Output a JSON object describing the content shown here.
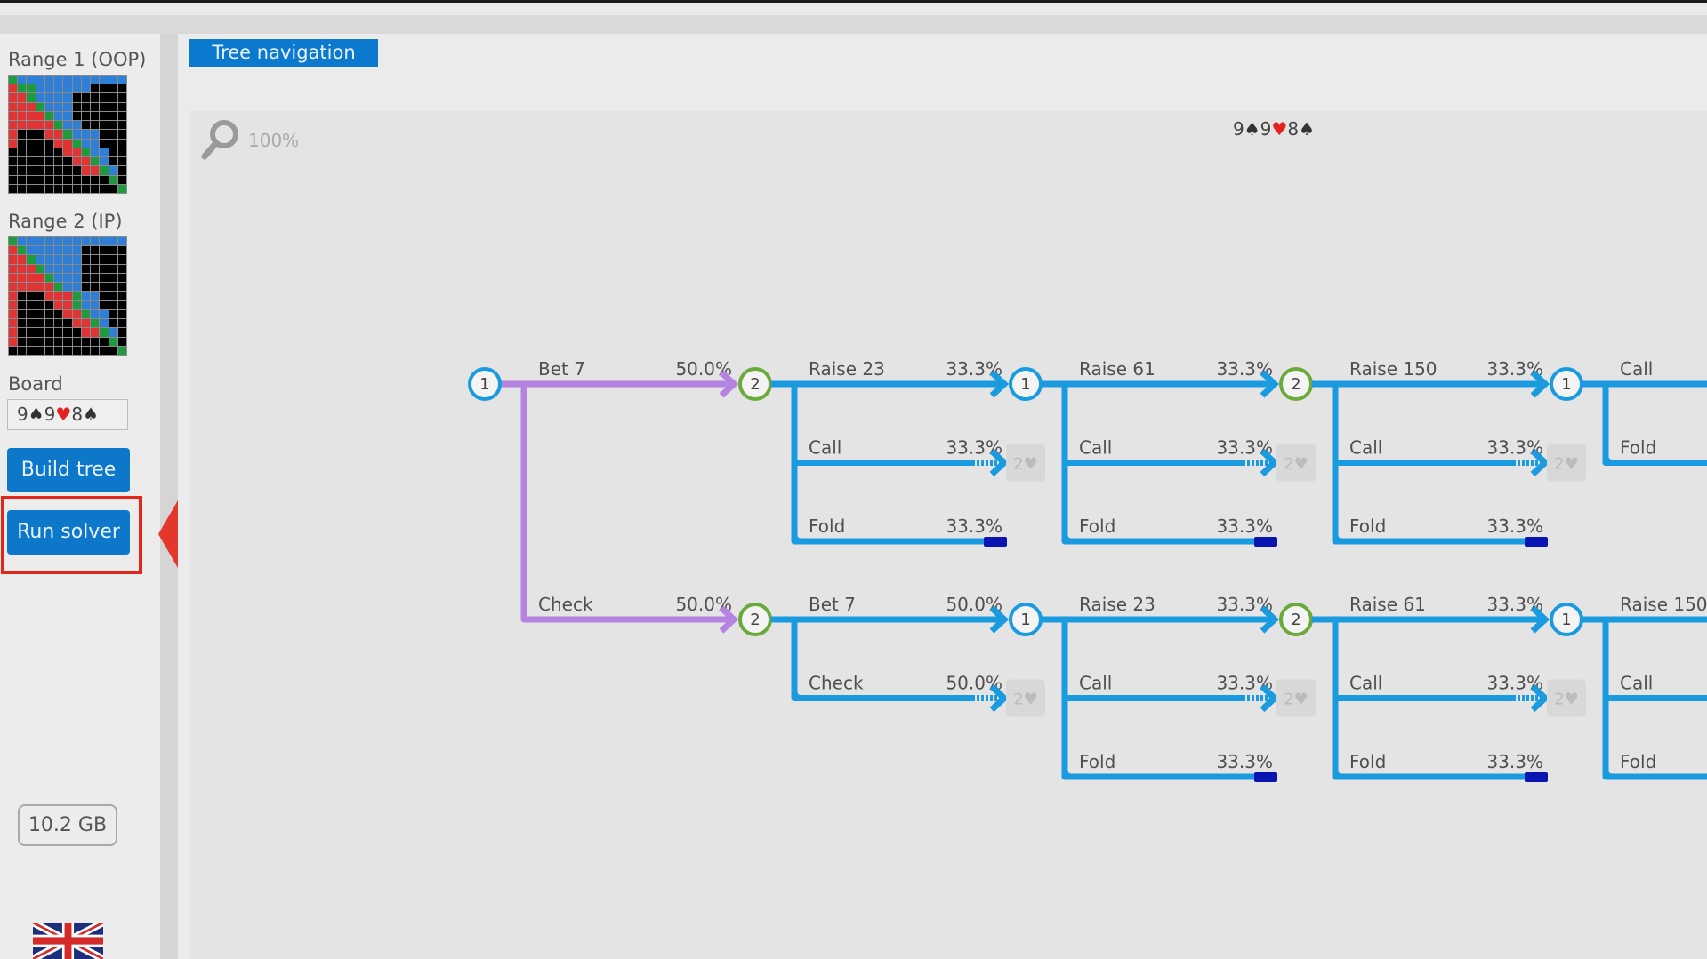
{
  "sidebar": {
    "range1_label": "Range 1 (OOP)",
    "range2_label": "Range 2 (IP)",
    "board_label": "Board",
    "board_cards": [
      {
        "rank": "9",
        "suit": "♠",
        "suit_color": "#333333"
      },
      {
        "rank": "9",
        "suit": "♥",
        "suit_color": "#e32222"
      },
      {
        "rank": "8",
        "suit": "♠",
        "suit_color": "#333333"
      }
    ],
    "build_tree_label": "Build tree",
    "run_solver_label": "Run solver",
    "memory_label": "10.2 GB",
    "language_flag": "uk-flag"
  },
  "range_colors": {
    "pair": "#1f9a3e",
    "suited": "#2f7fd6",
    "offsuit": "#e03434",
    "empty": "#000000"
  },
  "ranges": {
    "range1_rows": [
      "gsssssssssssss",
      "oggsssssseeee",
      "oogsssseeeee",
      "ooogssseeeee",
      "oooogsseeeee",
      "ooooogsseeee",
      "oeeeoogssseee",
      "oeeeeoogssee",
      "eeeeeeoogssee",
      "eeeeeeeoogse",
      "eeeeeeeeoogse",
      "eeeeeeeeeeege",
      "eeeeeeeeeeeeg"
    ],
    "range2_rows": [
      "gssssssssssss",
      "ogsssssseeee",
      "oogssssseeeee",
      "ooogsssseeee",
      "oooogssseeeee",
      "ooooogsseeeee",
      "oeeeooogsseee",
      "oeeeeoogsseee",
      "oeeeeeoogssee",
      "oeeeeeeoogsee",
      "oeeeeeeeoogse",
      "oeeeeeeeeeege",
      "eeeeeeeeeeeeg"
    ]
  },
  "main": {
    "tab_label": "Tree navigation",
    "zoom_label": "100%",
    "board_display": [
      {
        "rank": "9",
        "suit": "♠",
        "suit_color": "#333333"
      },
      {
        "rank": "9",
        "suit": "♥",
        "suit_color": "#e32222"
      },
      {
        "rank": "8",
        "suit": "♠",
        "suit_color": "#333333"
      }
    ]
  },
  "tree_colors": {
    "root_edge": "#b583e0",
    "edge": "#1a9be0",
    "p1_node": "#1a9be0",
    "p2_node": "#6aaa3c",
    "fold_terminal": "#0a14b0",
    "card_box": "#d8d8d8"
  },
  "tree": {
    "root": {
      "player": "1"
    },
    "root_actions": [
      {
        "label": "Bet 7",
        "pct": "50.0%",
        "next": "2"
      },
      {
        "label": "Check",
        "pct": "50.0%",
        "next": "2"
      }
    ],
    "next_card_label": "2♥",
    "groups": [
      {
        "columns": [
          {
            "actions": [
              {
                "label": "Raise 23",
                "pct": "33.3%",
                "type": "node",
                "next": "1"
              },
              {
                "label": "Call",
                "pct": "33.3%",
                "type": "card"
              },
              {
                "label": "Fold",
                "pct": "33.3%",
                "type": "fold"
              }
            ]
          },
          {
            "actions": [
              {
                "label": "Raise 61",
                "pct": "33.3%",
                "type": "node",
                "next": "2"
              },
              {
                "label": "Call",
                "pct": "33.3%",
                "type": "card"
              },
              {
                "label": "Fold",
                "pct": "33.3%",
                "type": "fold"
              }
            ]
          },
          {
            "actions": [
              {
                "label": "Raise 150",
                "pct": "33.3%",
                "type": "node",
                "next": "1"
              },
              {
                "label": "Call",
                "pct": "33.3%",
                "type": "card"
              },
              {
                "label": "Fold",
                "pct": "33.3%",
                "type": "fold"
              }
            ]
          },
          {
            "actions": [
              {
                "label": "Call",
                "pct": "",
                "type": "cut"
              },
              {
                "label": "Fold",
                "pct": "",
                "type": "cut"
              }
            ]
          }
        ]
      },
      {
        "columns": [
          {
            "actions": [
              {
                "label": "Bet 7",
                "pct": "50.0%",
                "type": "node",
                "next": "1"
              },
              {
                "label": "Check",
                "pct": "50.0%",
                "type": "card"
              }
            ]
          },
          {
            "actions": [
              {
                "label": "Raise 23",
                "pct": "33.3%",
                "type": "node",
                "next": "2"
              },
              {
                "label": "Call",
                "pct": "33.3%",
                "type": "card"
              },
              {
                "label": "Fold",
                "pct": "33.3%",
                "type": "fold"
              }
            ]
          },
          {
            "actions": [
              {
                "label": "Raise 61",
                "pct": "33.3%",
                "type": "node",
                "next": "1"
              },
              {
                "label": "Call",
                "pct": "33.3%",
                "type": "card"
              },
              {
                "label": "Fold",
                "pct": "33.3%",
                "type": "fold"
              }
            ]
          },
          {
            "actions": [
              {
                "label": "Raise 150",
                "pct": "",
                "type": "cut"
              },
              {
                "label": "Call",
                "pct": "",
                "type": "cut"
              },
              {
                "label": "Fold",
                "pct": "",
                "type": "cut"
              }
            ]
          }
        ]
      }
    ]
  }
}
